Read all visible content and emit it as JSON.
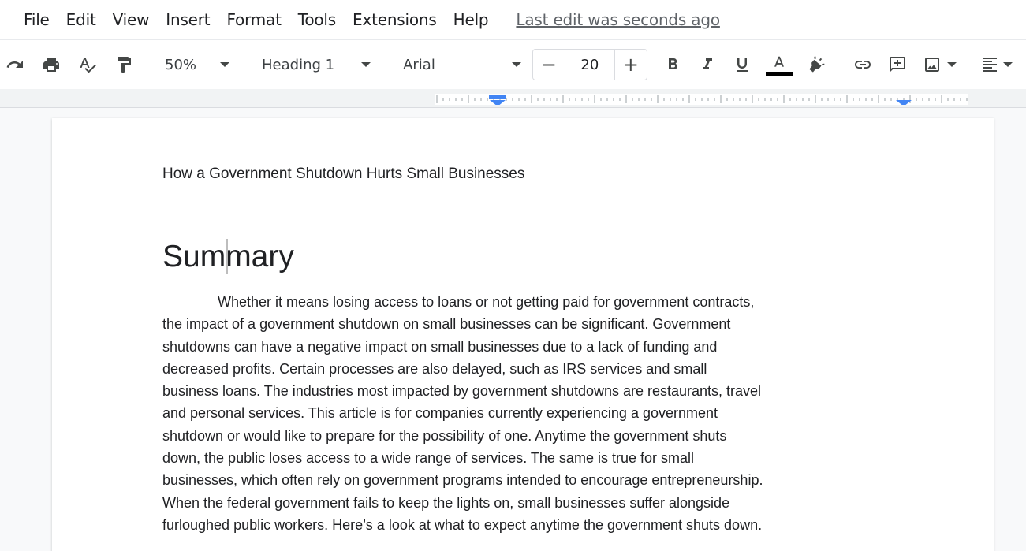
{
  "menu": {
    "items": [
      "File",
      "Edit",
      "View",
      "Insert",
      "Format",
      "Tools",
      "Extensions",
      "Help"
    ],
    "last_edit": "Last edit was seconds ago"
  },
  "toolbar": {
    "zoom": "50%",
    "style": "Heading 1",
    "font": "Arial",
    "font_size": "20",
    "decrement": "−",
    "increment": "+",
    "text_color": "#000000",
    "icons": [
      "redo-icon",
      "print-icon",
      "spellcheck-icon",
      "paint-format-icon",
      "bold-icon",
      "italic-icon",
      "underline-icon",
      "text-color-icon",
      "highlight-icon",
      "link-icon",
      "add-comment-icon",
      "insert-image-icon",
      "align-icon"
    ]
  },
  "document": {
    "title": "How a Government Shutdown Hurts Small Businesses",
    "heading": "Summary",
    "body_lines": [
      "Whether it means losing access to loans or not getting paid for government contracts,",
      "the impact of a government shutdown on small businesses can be significant. Government",
      "shutdowns can have a negative impact on small businesses due to a lack of funding and",
      "decreased profits. Certain processes are also delayed, such as IRS services and small",
      "business loans. The industries most impacted by government shutdowns are restaurants, travel",
      "and personal services. This article is for companies currently experiencing a government",
      "shutdown or would like to prepare for the possibility of one.  Anytime the government shuts",
      "down, the public loses access to a wide range of services. The same is true for small",
      "businesses, which often rely on government programs intended to encourage entrepreneurship.",
      "When the federal government fails to keep the lights on, small businesses suffer alongside",
      "furloughed public workers. Here’s a look at what to expect anytime the government shuts down."
    ]
  },
  "colors": {
    "accent": "#4285f4",
    "icon": "#444746",
    "text": "#202124"
  }
}
